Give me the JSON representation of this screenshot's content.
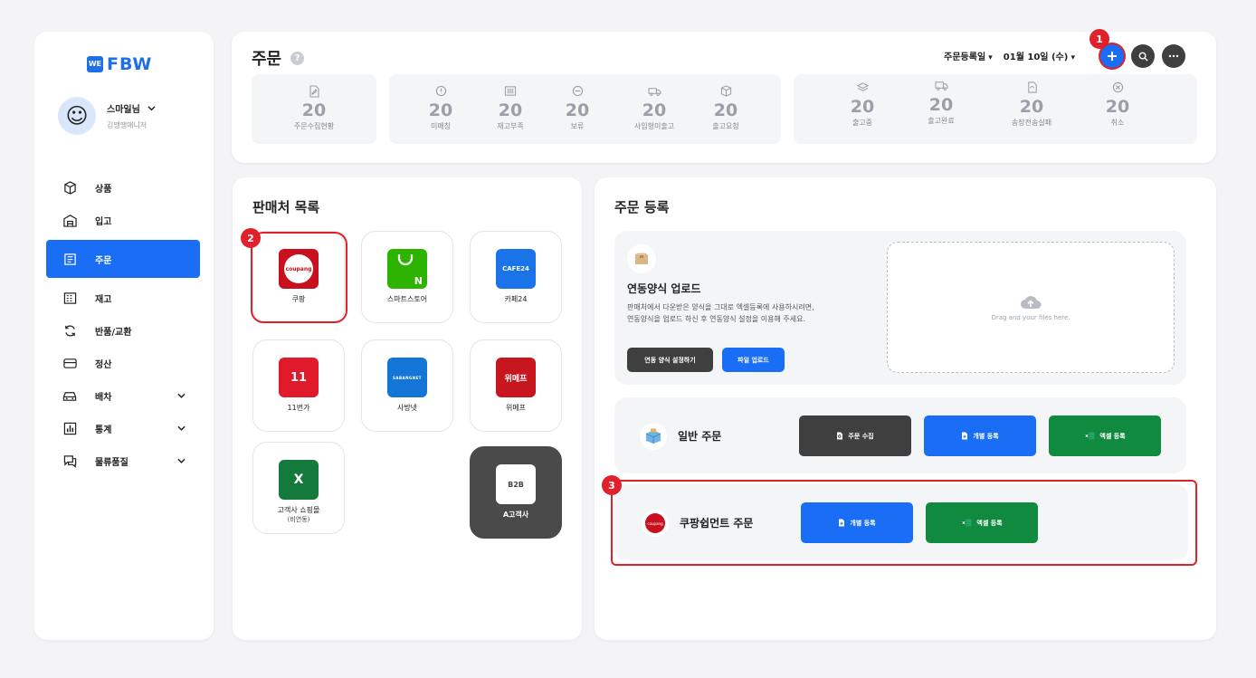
{
  "sidebar": {
    "logo_mark": "WE",
    "logo_text": "FBW",
    "user_name": "스마일님",
    "user_role": "김땡땡매니저",
    "items": [
      {
        "label": "상품"
      },
      {
        "label": "입고"
      },
      {
        "label": "주문"
      },
      {
        "label": "재고"
      },
      {
        "label": "반품/교환"
      },
      {
        "label": "정산"
      },
      {
        "label": "배차"
      },
      {
        "label": "통계"
      },
      {
        "label": "물류품질"
      }
    ]
  },
  "header": {
    "title": "주문",
    "help": "?",
    "date_type": "주문등록일",
    "date": "01월 10일 (수)",
    "add_icon": "plus-icon",
    "search_icon": "search-icon",
    "more_icon": "more-icon"
  },
  "stats": {
    "group1": [
      {
        "num": "20",
        "label": "주문수집현황"
      }
    ],
    "group2": [
      {
        "num": "20",
        "label": "미매칭"
      },
      {
        "num": "20",
        "label": "재고부족"
      },
      {
        "num": "20",
        "label": "보류"
      },
      {
        "num": "20",
        "label": "사입형미출고"
      },
      {
        "num": "20",
        "label": "출고요청"
      }
    ],
    "group3": [
      {
        "num": "20",
        "label": "출고중"
      },
      {
        "num": "20",
        "label": "출고완료"
      },
      {
        "num": "20",
        "label": "송장전송실패"
      },
      {
        "num": "20",
        "label": "취소"
      }
    ]
  },
  "vendors": {
    "title": "판매처 목록",
    "items": [
      {
        "name": "쿠팡",
        "logo": "coupang"
      },
      {
        "name": "스마트스토어",
        "logo": "N"
      },
      {
        "name": "카페24",
        "logo": "CAFE24"
      },
      {
        "name": "11번가",
        "logo": "11"
      },
      {
        "name": "사방넷",
        "logo": "SABANGNET"
      },
      {
        "name": "위메프",
        "logo": "위메프"
      },
      {
        "name": "고객사 쇼핑몰",
        "sub": "(비연동)",
        "logo": "X"
      },
      {
        "name": "A고객사",
        "logo": "B2B"
      }
    ]
  },
  "register": {
    "title": "주문 등록",
    "upload_title": "연동양식 업로드",
    "upload_desc_1": "판매처에서 다운받은 양식을 그대로 엑셀등록에 사용하시려면,",
    "upload_desc_2": "연동양식을 업로드 하신 후 연동양식 설정을 이용해 주세요.",
    "btn_setting": "연동 양식 설정하기",
    "btn_file_upload": "파일 업로드",
    "dropzone_text": "Drag and your files here.",
    "general_title": "일반 주문",
    "btn_collect": "주문 수집",
    "btn_single": "개별 등록",
    "btn_excel": "엑셀 등록",
    "coupang_title": "쿠팡쉽먼트 주문",
    "btn_single2": "개별 등록",
    "btn_excel2": "엑셀 등록"
  },
  "markers": {
    "m1": "1",
    "m2": "2",
    "m3": "3"
  },
  "colors": {
    "accent": "#1a6ef5",
    "highlight": "#e0202a",
    "excel": "#108a3e",
    "dark_button": "#3f3f3f"
  }
}
